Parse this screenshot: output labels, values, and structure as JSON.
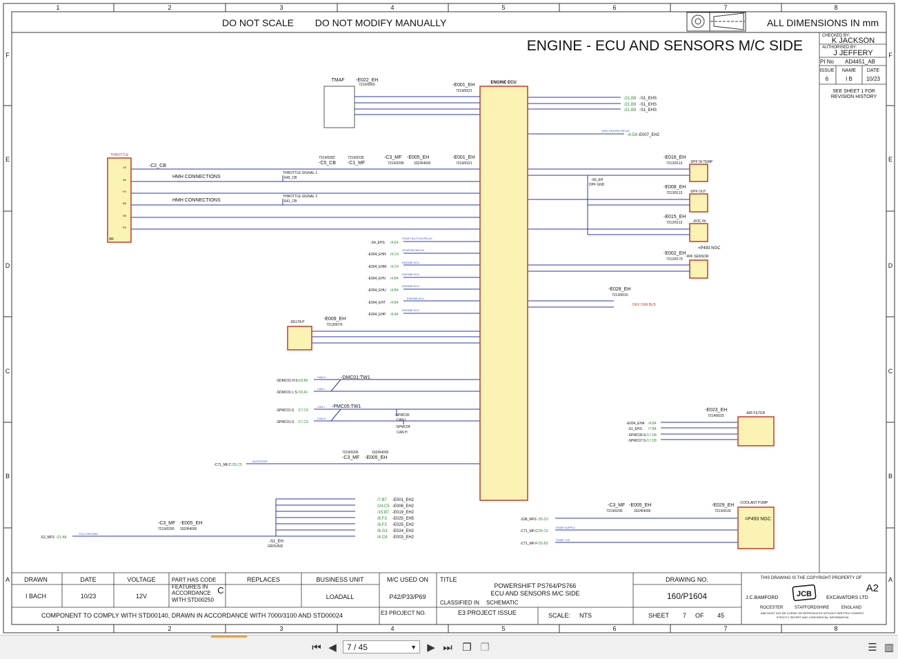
{
  "header": {
    "notice1": "DO NOT SCALE",
    "notice2": "DO NOT MODIFY MANUALLY",
    "dimensions": "ALL DIMENSIONS IN mm",
    "title": "ENGINE - ECU AND SENSORS M/C SIDE"
  },
  "grid": {
    "cols": [
      "1",
      "2",
      "3",
      "4",
      "5",
      "6",
      "7",
      "8"
    ],
    "rows": [
      "F",
      "E",
      "D",
      "C",
      "B",
      "A"
    ]
  },
  "approval": {
    "checked_label": "CHECKED BY:",
    "checked": "K JACKSON",
    "auth_label": "AUTHORISED BY:",
    "auth": "J JEFFERY",
    "pino_label": "PI No",
    "pino": "AD4451_AB",
    "issue_label": "ISSUE",
    "name_label": "NAME",
    "date_label": "DATE",
    "issue": "6",
    "name": "I B",
    "date": "10/23",
    "see1": "SEE SHEET 1 FOR",
    "see2": "REVISION HISTORY"
  },
  "components": {
    "tmaf": "TMAF",
    "e022": "-E022_EH",
    "e022_pn": "7216/0060",
    "ecu_title": "ENGINE ECU",
    "e001": "-E001_EH",
    "e001_pn": "7219/0321",
    "throttle": "THROTTLE",
    "c2cb": "-C2_CB",
    "b6": "-B6",
    "hmh1": "HMH CONNECTIONS",
    "hmh2": "HMH CONNECTIONS",
    "ts1": "THROTTLE SIGNAL 1",
    "ts1b": "-S40_CB",
    "ts2": "THROTTLE SIGNAL 2",
    "ts2b": "-S41_CB",
    "c5cb": "-C5_CB",
    "c5pn": "7219/0282",
    "c1mf": "-C1_MF",
    "c1pn": "7219/0236",
    "c3mf": "-C3_MF",
    "c3pn": "7219/0295",
    "e005": "-E005_EH",
    "e005pn": "332/R4000",
    "e001b": "-E001_EH",
    "e001bpn": "7219/0321",
    "e016": "-E016_EH",
    "e016pn": "7212/0113",
    "dpf_in": "-DPF IN TEMP",
    "e008": "-E008_EH",
    "e008pn": "7212/0113",
    "dpf_out": "-DPF OUT",
    "e015": "-E015_EH",
    "e015pn": "7212/0113",
    "doc_in": "-DOC IN",
    "s6": "-S6_EH",
    "dpf_gnd": "DPF GND",
    "p493a": "=P493 NGC",
    "e002": "-E002_EH",
    "e002pn": "7212/0179",
    "wif": "-WIF SENSOR",
    "e028": "-E028_EH",
    "e028pn": "7213/0015",
    "devcan": "DEV CAN BUS",
    "e007": "-E007_EH2",
    "grid_heater": "GRID HEATER RELAY",
    "e009": "-E009_EH",
    "e009pn": "7213/0076",
    "delta": "-DELTA P",
    "dmc": "-DMC01:TW1",
    "pmc": "-PMC05:TW1",
    "spmc05": "-SPMC05",
    "canl": "CAN L",
    "spmc04": "-SPMC04",
    "canh": "CAN H",
    "e023": "-E023_EH",
    "e023pn": "7214/0025",
    "airfilter": "-AIR FILTER",
    "c3mf2": "-C3_MF",
    "c3pn2": "7219/0295",
    "e005b": "-E005_EH",
    "e005bpn": "332/R4000",
    "c3mf3": "-C3_MF",
    "c3pn3": "7219/0295",
    "e005c": "-E005_EH",
    "e005cpn": "332/R4000",
    "e029": "-E029_EH",
    "e029pn": "7213/0100",
    "coolant": "-COOLANT PUMP",
    "p493b": "=P493 NGC",
    "c3mf4": "-C3_MF",
    "c3pn4": "7219/0295",
    "e005d": "-E005_EH",
    "e005dpn": "332/R4000",
    "s1": "-S1_EH",
    "ground": "GROUND",
    "throttle_pins": [
      "C6",
      "A6",
      "F6",
      "B6",
      "D6",
      "E6"
    ]
  },
  "xrefs": {
    "top": [
      {
        "ref": "/21.B9",
        "tag": "-S1_EHS"
      },
      {
        "ref": "/21.B9",
        "tag": "-S1_EHS"
      },
      {
        "ref": "/21.B9",
        "tag": "-S1_EHS"
      }
    ],
    "grid": "/4.D6",
    "left": [
      {
        "tag": "-S4_EHS",
        "ref": "/4.E4",
        "note": "START BUTTON RELAY"
      },
      {
        "tag": "-E004_EHN",
        "ref": "/4.C4",
        "note": "STARTER RELAY"
      },
      {
        "tag": "-E004_EHM",
        "ref": "/4.C4",
        "note": "ENGINE ECU"
      },
      {
        "tag": "-E004_EHV",
        "ref": "/4.B4",
        "note": "ENGINE ECU"
      },
      {
        "tag": "-E004_EHU",
        "ref": "/4.B4",
        "note": "ENGINE ECU"
      },
      {
        "tag": "-E004_EHT",
        "ref": "/4.B4",
        "note": "ENGINE ECU"
      },
      {
        "tag": "-E004_EHP",
        "ref": "/4.A4",
        "note": "ENGINE ECU"
      }
    ],
    "can": [
      {
        "tag": "-SDMC01:H:S",
        "ref": "/18.B6",
        "note": "CAN H"
      },
      {
        "tag": "-SDMC01:L:S",
        "ref": "/18.A1",
        "note": "CAN L"
      },
      {
        "tag": "-SPMC01:S",
        "ref": "/17.C9",
        "note": "CAN L"
      },
      {
        "tag": "-SPMC01:S",
        "ref": "/17.C9",
        "note": "CAN H"
      }
    ],
    "autostop": {
      "tag": "-C71_MF.C",
      "ref": "/25.C5",
      "note": "AUTOSTOP"
    },
    "ground_refs": [
      {
        "ref": "/7.B7",
        "tag": "-E001_EH2"
      },
      {
        "ref": "/24.C5",
        "tag": "-E006_EH2"
      },
      {
        "ref": "/15.B7",
        "tag": "-E019_EH2"
      },
      {
        "ref": "/8.F3",
        "tag": "-E025_EH5"
      },
      {
        "ref": "/8.F3",
        "tag": "-E025_EH2"
      },
      {
        "ref": "/6.G3",
        "tag": "-E024_EH2"
      },
      {
        "ref": "/4.C8",
        "tag": "-E003_EH2"
      }
    ],
    "ground_left": {
      "tag": "-S3_MFS",
      "ref": "/21.A8",
      "note": "ECU GROUND"
    },
    "air": [
      {
        "tag": "-E004_EHA",
        "ref": "/4.B4"
      },
      {
        "tag": "-S1_EHS",
        "ref": "/7.B4"
      },
      {
        "tag": "-SPMC06:S",
        "ref": "/17.D8"
      },
      {
        "tag": "-SPMC07:S",
        "ref": "/17.D8"
      }
    ],
    "coolant": [
      {
        "tag": "-S38_MFS",
        "ref": "/25.D3"
      },
      {
        "tag": "-C71_MF:C",
        "ref": "/25.C5",
        "note": "PUMP SUPPLY"
      },
      {
        "tag": "-C71_MF:F",
        "ref": "/25.B3",
        "note": "PUMP +VE"
      }
    ]
  },
  "title_block": {
    "drawn_label": "DRAWN",
    "drawn": "I BACH",
    "date_label": "DATE",
    "date": "10/23",
    "voltage_label": "VOLTAGE",
    "voltage": "12V",
    "code1": "PART HAS CODE",
    "code2": "FEATURES IN",
    "code3": "ACCORDANCE",
    "code4": "WITH STD00250",
    "code_letter": "C",
    "replaces_label": "REPLACES",
    "bu_label": "BUSINESS UNIT",
    "bu": "LOADALL",
    "mc_label": "M/C USED ON",
    "mc": "P42/P33/P69",
    "title_label": "TITLE",
    "title1": "POWERSHIFT PS764/PS766",
    "title2": "ECU AND SENSORS M/C SIDE",
    "classified_label": "CLASSIFIED IN",
    "classified": "SCHEMATIC",
    "drawing_label": "DRAWING NO.",
    "drawing": "160/P1604",
    "copyright": "THIS DRAWING IS THE COPYRIGHT PROPERTY OF",
    "size": "A2",
    "company1": "J.C.BAMFORD",
    "company2": "EXCAVATORS LTD",
    "addr1": "ROCESTER",
    "addr2": "STAFFORDSHIRE",
    "addr3": "ENGLAND",
    "logo": "JCB",
    "legal1": "AND MUST NOT BE COPIED OR REPRODUCED WITHOUT WRITTEN CONSENT.",
    "legal2": "STRICTLY SECRET AND CONFIDENTIAL INFORMATION",
    "comply": "COMPONENT TO COMPLY WITH STD00140, DRAWN IN ACCORDANCE WITH 7000/3100 AND STD00024",
    "e3proj_label": "E3 PROJECT NO.",
    "e3issue_label": "E3 PROJECT ISSUE",
    "scale_label": "SCALE:",
    "scale": "NTS",
    "sheet_label": "SHEET",
    "sheet": "7",
    "of_label": "OF",
    "of": "45"
  },
  "viewer": {
    "page": "7 / 45"
  },
  "colors": {
    "wire": "#2436a8",
    "ecu_fill": "#fbf3b3",
    "comp_border": "#c0392b",
    "xref": "#2a8a2a",
    "note": "#2b50c8"
  }
}
